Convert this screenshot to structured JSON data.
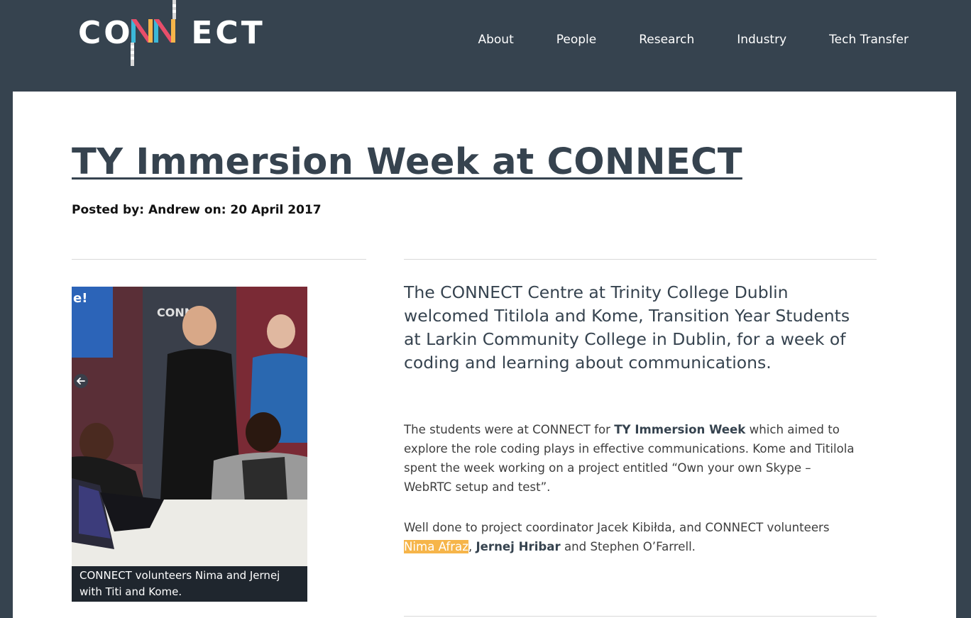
{
  "header": {
    "logo_text": "CONNECT",
    "nav": [
      "About",
      "People",
      "Research",
      "Industry",
      "Tech Transfer"
    ]
  },
  "article": {
    "title": "TY Immersion Week at CONNECT",
    "meta": "Posted by: Andrew on: 20 April 2017",
    "image_caption": "CONNECT volunteers Nima and Jernej with Titi and Kome.",
    "lead": "The CONNECT Centre at Trinity College Dublin welcomed Titilola and Kome, Transition Year Students at Larkin Community College in Dublin, for a week of coding and learning about communications.",
    "p1_part1": "The students were at CONNECT for ",
    "p1_bold": "TY Immersion Week",
    "p1_part2": " which aimed to explore the role coding plays in effective communications. Kome and Titilola spent the week working on a project entitled “Own your own Skype – WebRTC setup and test”.",
    "p2_part1": "Well done to project coordinator Jacek Kibiłda, and CONNECT volunteers ",
    "p2_highlight": "Nima Afraz",
    "p2_comma": ", ",
    "p2_bold": "Jernej Hribar",
    "p2_part2": " and Stephen O’Farrell."
  },
  "colors": {
    "header_bg": "#36434f",
    "highlight": "#f6b54a",
    "logo_n1": "#3cb8d8",
    "logo_n2": "#e84e6a",
    "logo_n3": "#f6b54a"
  },
  "icons": {
    "photo_prev": "arrow-left-icon"
  }
}
